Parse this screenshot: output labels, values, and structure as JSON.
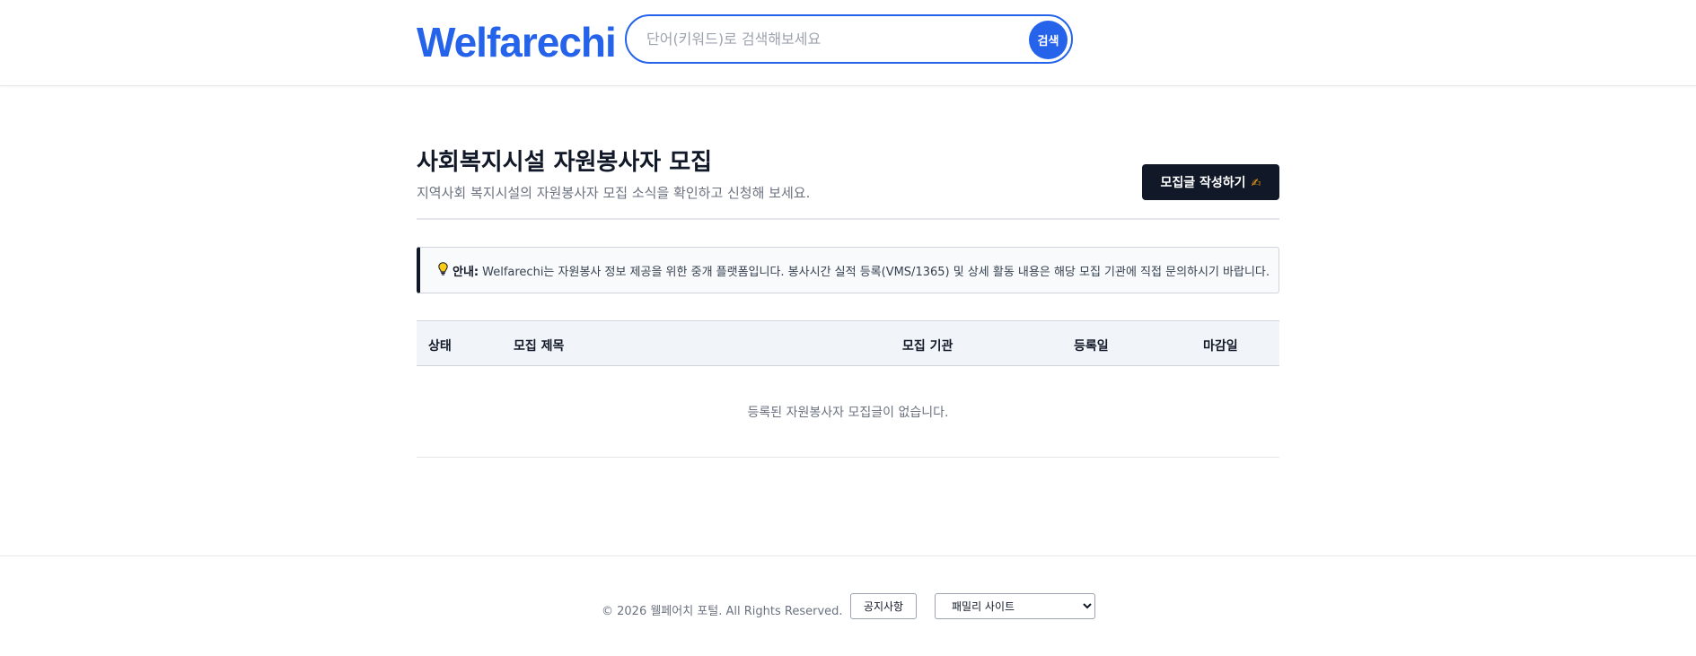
{
  "header": {
    "logo": "Welfarechi",
    "search_placeholder": "단어(키워드)로 검색해보세요",
    "search_button": "검색"
  },
  "main": {
    "title": "사회복지시설 자원봉사자 모집",
    "subtitle": "지역사회 복지시설의 자원봉사자 모집 소식을 확인하고 신청해 보세요.",
    "write_button": "모집글 작성하기",
    "write_icon": "✍"
  },
  "notice": {
    "icon": "lightbulb-icon",
    "label": "안내:",
    "text": "Welfarechi는 자원봉사 정보 제공을 위한 중개 플랫폼입니다. 봉사시간 실적 등록(VMS/1365) 및 상세 활동 내용은 해당 모집 기관에 직접 문의하시기 바랍니다."
  },
  "table": {
    "columns": [
      "상태",
      "모집 제목",
      "모집 기관",
      "등록일",
      "마감일"
    ],
    "empty_message": "등록된 자원봉사자 모집글이 없습니다."
  },
  "footer": {
    "copyright": "© 2026 웰페어치 포털. All Rights Reserved.",
    "notice_button": "공지사항",
    "family_site": "패밀리 사이트"
  },
  "colors": {
    "brand": "#2563eb",
    "dark": "#111827"
  }
}
